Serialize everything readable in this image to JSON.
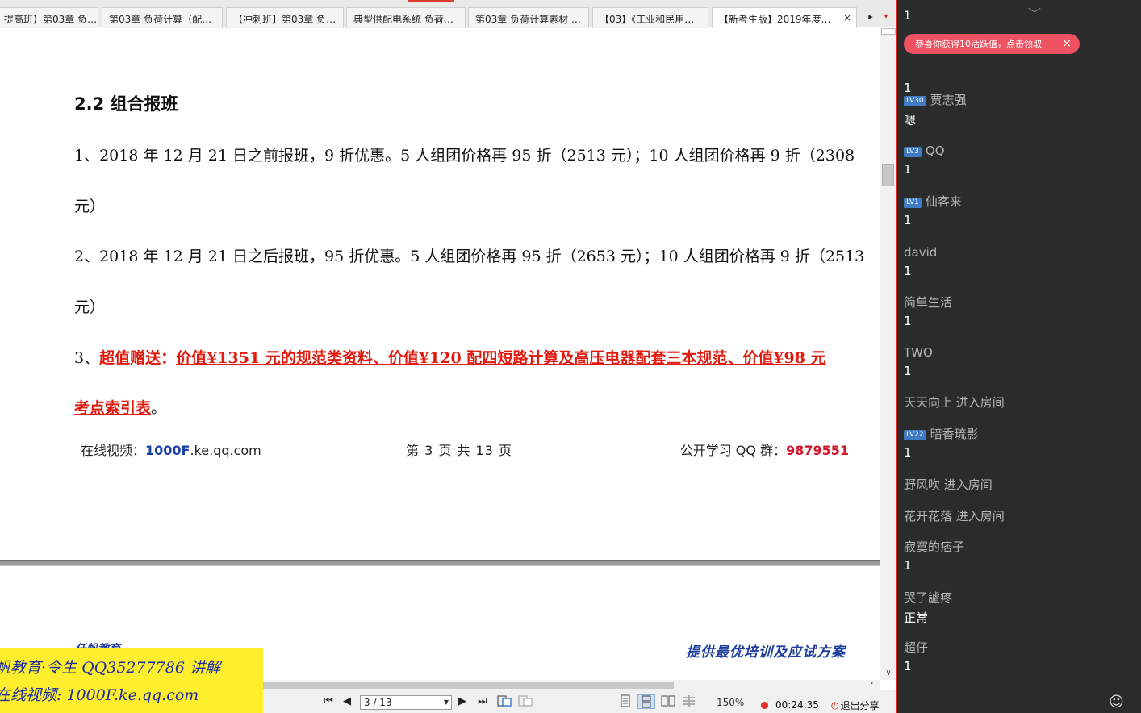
{
  "tabs": [
    {
      "label": "提高班】第03章 负…",
      "active": false
    },
    {
      "label": "第03章 负荷计算（配…",
      "active": false
    },
    {
      "label": "【冲刺班】第03章 负…",
      "active": false
    },
    {
      "label": "典型供配电系统 负荷…",
      "active": false
    },
    {
      "label": "第03章 负荷计算素材 …",
      "active": false
    },
    {
      "label": "【03】《工业和民用…",
      "active": false
    },
    {
      "label": "【新考生版】2019年度…",
      "active": true,
      "close": "×"
    }
  ],
  "tab_nav": {
    "scroll_right": "▸",
    "dropdown": "▾"
  },
  "document": {
    "heading": "2.2  组合报班",
    "item1_line1": "1、2018 年 12 月 21 日之前报班，9 折优惠。5 人组团价格再 95 折（2513 元）；10 人组团价格再 9 折（2308",
    "item1_line2": "元）",
    "item2_line1": "2、2018 年 12 月 21 日之后报班，95 折优惠。5 人组团价格再 95 折（2653 元）；10 人组团价格再 9 折（2513",
    "item2_line2": "元）",
    "item3_prefix": "3、",
    "item3_label": "超值赠送：",
    "item3_text1": "价值¥1351 元的规范类资料、价值¥120 配四短路计算及高压电器配套三本规范、价值¥98 元",
    "item3_text2": "考点索引表",
    "item3_end": "。",
    "footer_video_label": "在线视频：",
    "footer_video_link": "1000F",
    "footer_video_domain": ".ke.qq.com",
    "footer_page": "第 3 页 共 13 页",
    "footer_qq_label": "公开学习 QQ 群：",
    "footer_qq_number": "9879551",
    "next_header_left": "仟帆教育",
    "next_header_right": "提供最优培训及应试方案"
  },
  "toolbar": {
    "first_page": "⏮",
    "prev_page": "◀",
    "page_value": "3 / 13",
    "next_page": "▶",
    "last_page": "⏭",
    "zoom": "150%",
    "rec_time": "00:24:35",
    "exit_share": "退出分享",
    "exit_icon": "⏻"
  },
  "watermark": {
    "line1": "帆教育·令生 QQ35277786 讲解",
    "line2": "在线视频: 1000F.ke.qq.com"
  },
  "chat": {
    "collapse_icon": "﹀",
    "top_partial": "1",
    "notification": "恭喜你获得10活跃值，点击领取",
    "notification_close": "×",
    "messages": [
      {
        "lv": "LV30",
        "name": "贾志强",
        "text": "嗯"
      },
      {
        "lv": "LV3",
        "name": "QQ",
        "text": "1"
      },
      {
        "lv": "LV1",
        "name": "仙客来",
        "text": "1"
      },
      {
        "lv": "",
        "name": "david",
        "text": "1"
      },
      {
        "lv": "",
        "name": "简单生活",
        "text": "1"
      },
      {
        "lv": "",
        "name": "TWO",
        "text": "1"
      },
      {
        "lv": "",
        "name": "天天向上 进入房间",
        "text": ""
      },
      {
        "lv": "LV22",
        "name": "暗香琉影",
        "text": "1"
      },
      {
        "lv": "",
        "name": "野风吹 进入房间",
        "text": ""
      },
      {
        "lv": "",
        "name": "花开花落 进入房间",
        "text": ""
      },
      {
        "lv": "",
        "name": "寂寞的痞子",
        "text": "1"
      },
      {
        "lv": "",
        "name": "哭了謯疼",
        "text": "正常"
      },
      {
        "lv": "",
        "name": "超仔",
        "text": "1"
      }
    ],
    "emoji_icon": "☺"
  },
  "colors": {
    "accent_red": "#e01b10",
    "link_blue": "#1d3fa8",
    "chat_bg": "#2b2b2b",
    "notif": "#f05262"
  }
}
